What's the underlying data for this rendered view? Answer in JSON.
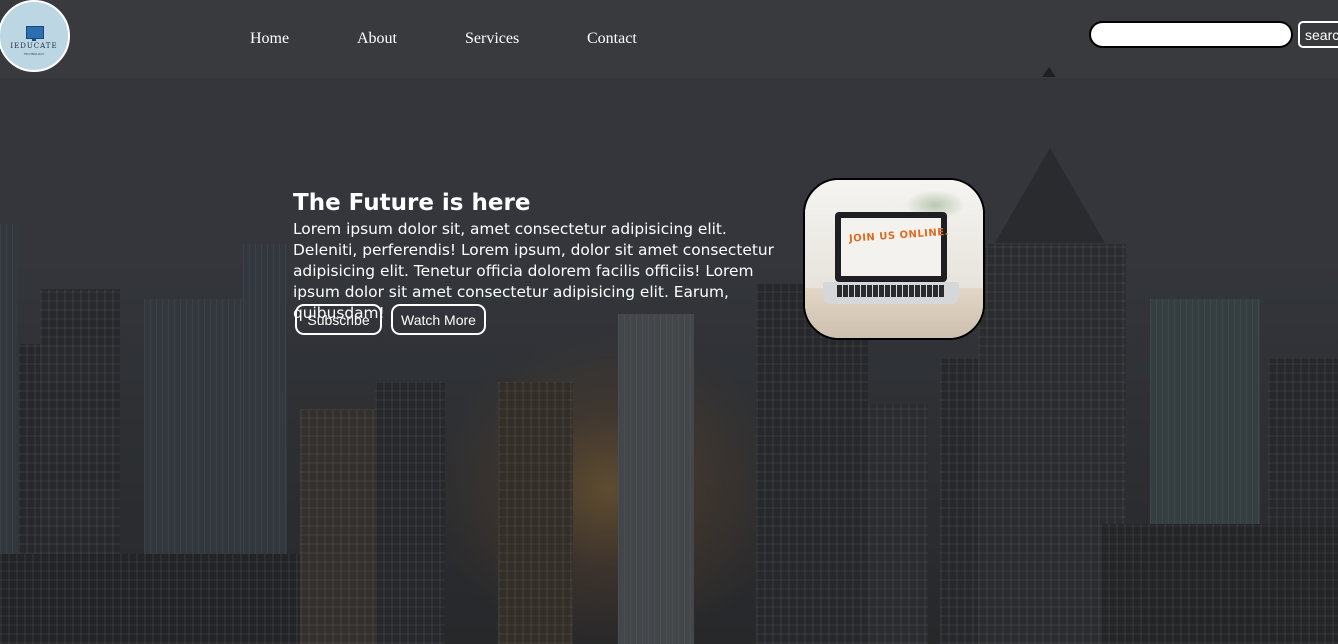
{
  "brand": {
    "logo_text": "IEDUCATE",
    "logo_subtext": "TECHNOLOGY",
    "colors": {
      "logo_bg": "#bcd6e4",
      "logo_icon": "#2c6fb0"
    }
  },
  "nav": {
    "items": [
      {
        "label": "Home"
      },
      {
        "label": "About"
      },
      {
        "label": "Services"
      },
      {
        "label": "Contact"
      }
    ]
  },
  "search": {
    "placeholder": "",
    "value": "",
    "button_label": "search"
  },
  "hero": {
    "title": "The Future is here",
    "text": "Lorem ipsum dolor sit, amet consectetur adipisicing elit. Deleniti, perferendis! Lorem ipsum, dolor sit amet consectetur adipisicing elit. Tenetur officia dolorem facilis officiis! Lorem ipsum dolor sit amet consectetur adipisicing elit. Earum, quibusdam!",
    "subscribe_label": "Subscribe",
    "watch_label": "Watch More",
    "image_text": "JOIN US ONLINE."
  },
  "colors": {
    "text": "#ffffff",
    "accent_orange": "#e06b22",
    "navbar_bg": "#3c3e42"
  }
}
